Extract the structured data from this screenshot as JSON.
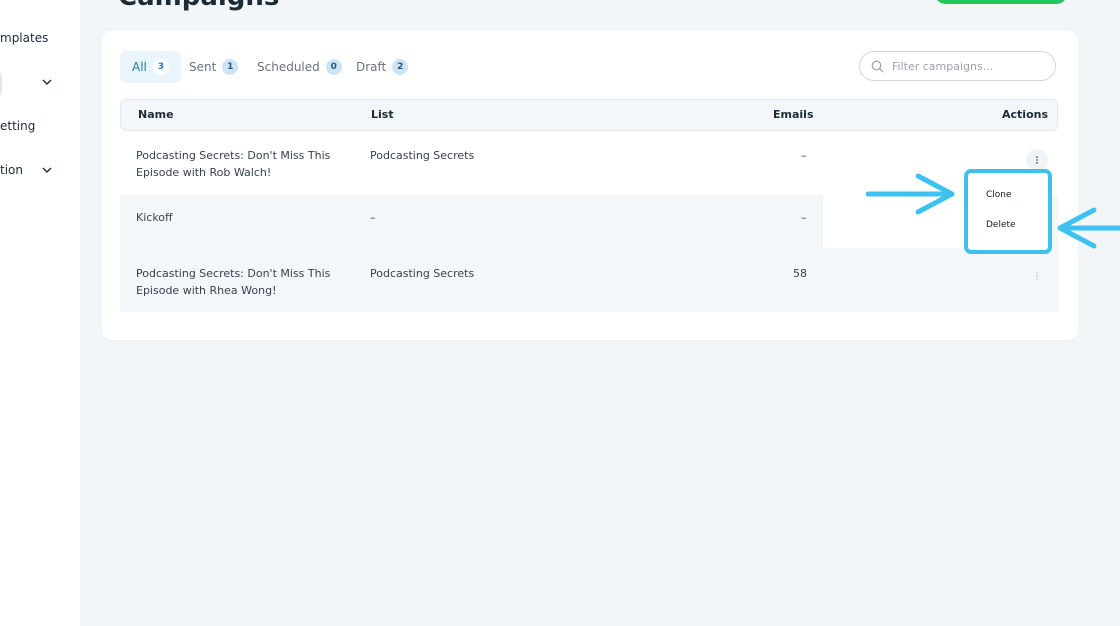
{
  "sidebar": {
    "items": [
      {
        "label": "mplates",
        "chevron": false
      },
      {
        "label": "",
        "chevron": true
      },
      {
        "label": "etting",
        "chevron": false
      },
      {
        "label": "tion",
        "chevron": true
      }
    ]
  },
  "page": {
    "title": "Campaigns"
  },
  "tabs": [
    {
      "label": "All",
      "count": "3",
      "active": true
    },
    {
      "label": "Sent",
      "count": "1",
      "active": false
    },
    {
      "label": "Scheduled",
      "count": "0",
      "active": false
    },
    {
      "label": "Draft",
      "count": "2",
      "active": false
    }
  ],
  "search": {
    "placeholder": "Filter campaigns...",
    "value": ""
  },
  "table": {
    "headers": {
      "name": "Name",
      "list": "List",
      "emails": "Emails",
      "actions": "Actions"
    },
    "rows": [
      {
        "name_line1": "Podcasting Secrets: Don't Miss This",
        "name_line2": "Episode with Rob Walch!",
        "list": "Podcasting Secrets",
        "emails": "–"
      },
      {
        "name_line1": "Kickoff",
        "name_line2": "",
        "list": "–",
        "emails": "–"
      },
      {
        "name_line1": "Podcasting Secrets: Don't Miss This",
        "name_line2": "Episode with Rhea Wong!",
        "list": "Podcasting Secrets",
        "emails": "58"
      }
    ]
  },
  "row_menu": {
    "items": [
      "Clone",
      "Delete"
    ]
  },
  "colors": {
    "accent": "#1e7fb3",
    "highlight": "#3fc1f0",
    "create_button": "#22c55e"
  }
}
